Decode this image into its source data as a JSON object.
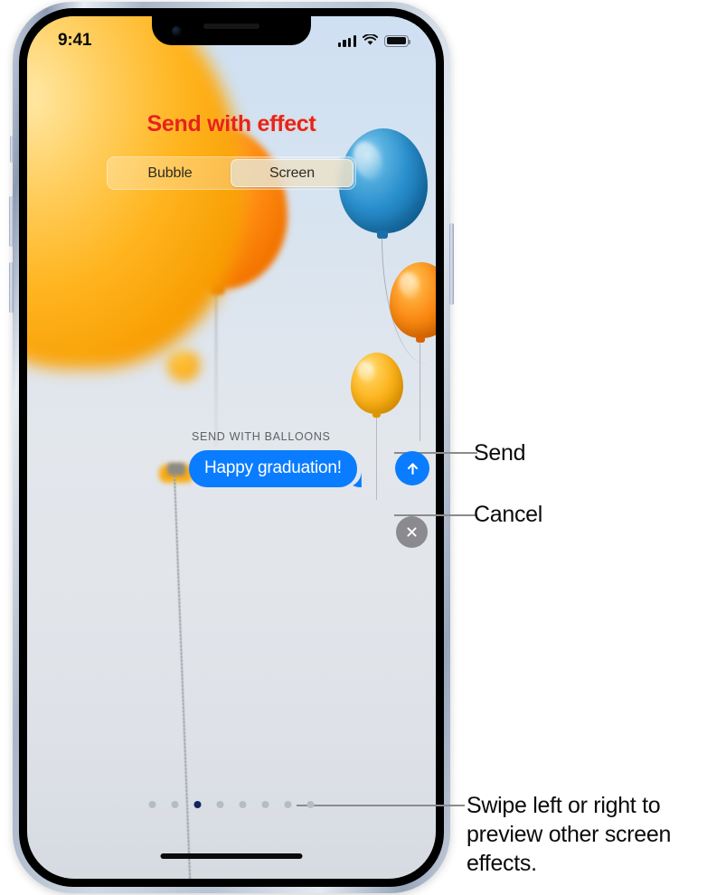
{
  "device": {
    "name": "iphone",
    "status_bar": {
      "time": "9:41",
      "signal_icon": "cellular-signal-icon",
      "wifi_icon": "wifi-icon",
      "battery_icon": "battery-full-icon"
    },
    "home_indicator": "home-indicator"
  },
  "screen": {
    "title": "Send with effect",
    "title_color": "#e8231a",
    "segmented_control": {
      "options": [
        {
          "label": "Bubble",
          "selected": false
        },
        {
          "label": "Screen",
          "selected": true
        }
      ]
    },
    "effect_label": "SEND WITH BALLOONS",
    "message": {
      "text": "Happy graduation!",
      "bubble_color": "#0a7cff",
      "text_color": "#ffffff"
    },
    "send_button": {
      "icon": "arrow-up-icon",
      "color": "#0a7cff"
    },
    "cancel_button": {
      "icon": "close-x-icon",
      "color": "#8a8a8f"
    },
    "page_dots": {
      "count": 8,
      "active_index": 2,
      "active_color": "#13255c",
      "inactive_color": "#b5bcc6"
    },
    "scene": {
      "description": "balloons-screen-effect",
      "balloons": [
        {
          "name": "balloon-hero",
          "color": "#ffb51f"
        },
        {
          "name": "balloon-orange-large",
          "color": "#ff8c12"
        },
        {
          "name": "balloon-blue",
          "color": "#2a8fcd"
        },
        {
          "name": "balloon-orange-small",
          "color": "#fb8b15"
        },
        {
          "name": "balloon-yellow",
          "color": "#fcb21a"
        }
      ]
    }
  },
  "callouts": {
    "send": "Send",
    "cancel": "Cancel",
    "swipe": "Swipe left or right to preview other screen effects."
  }
}
